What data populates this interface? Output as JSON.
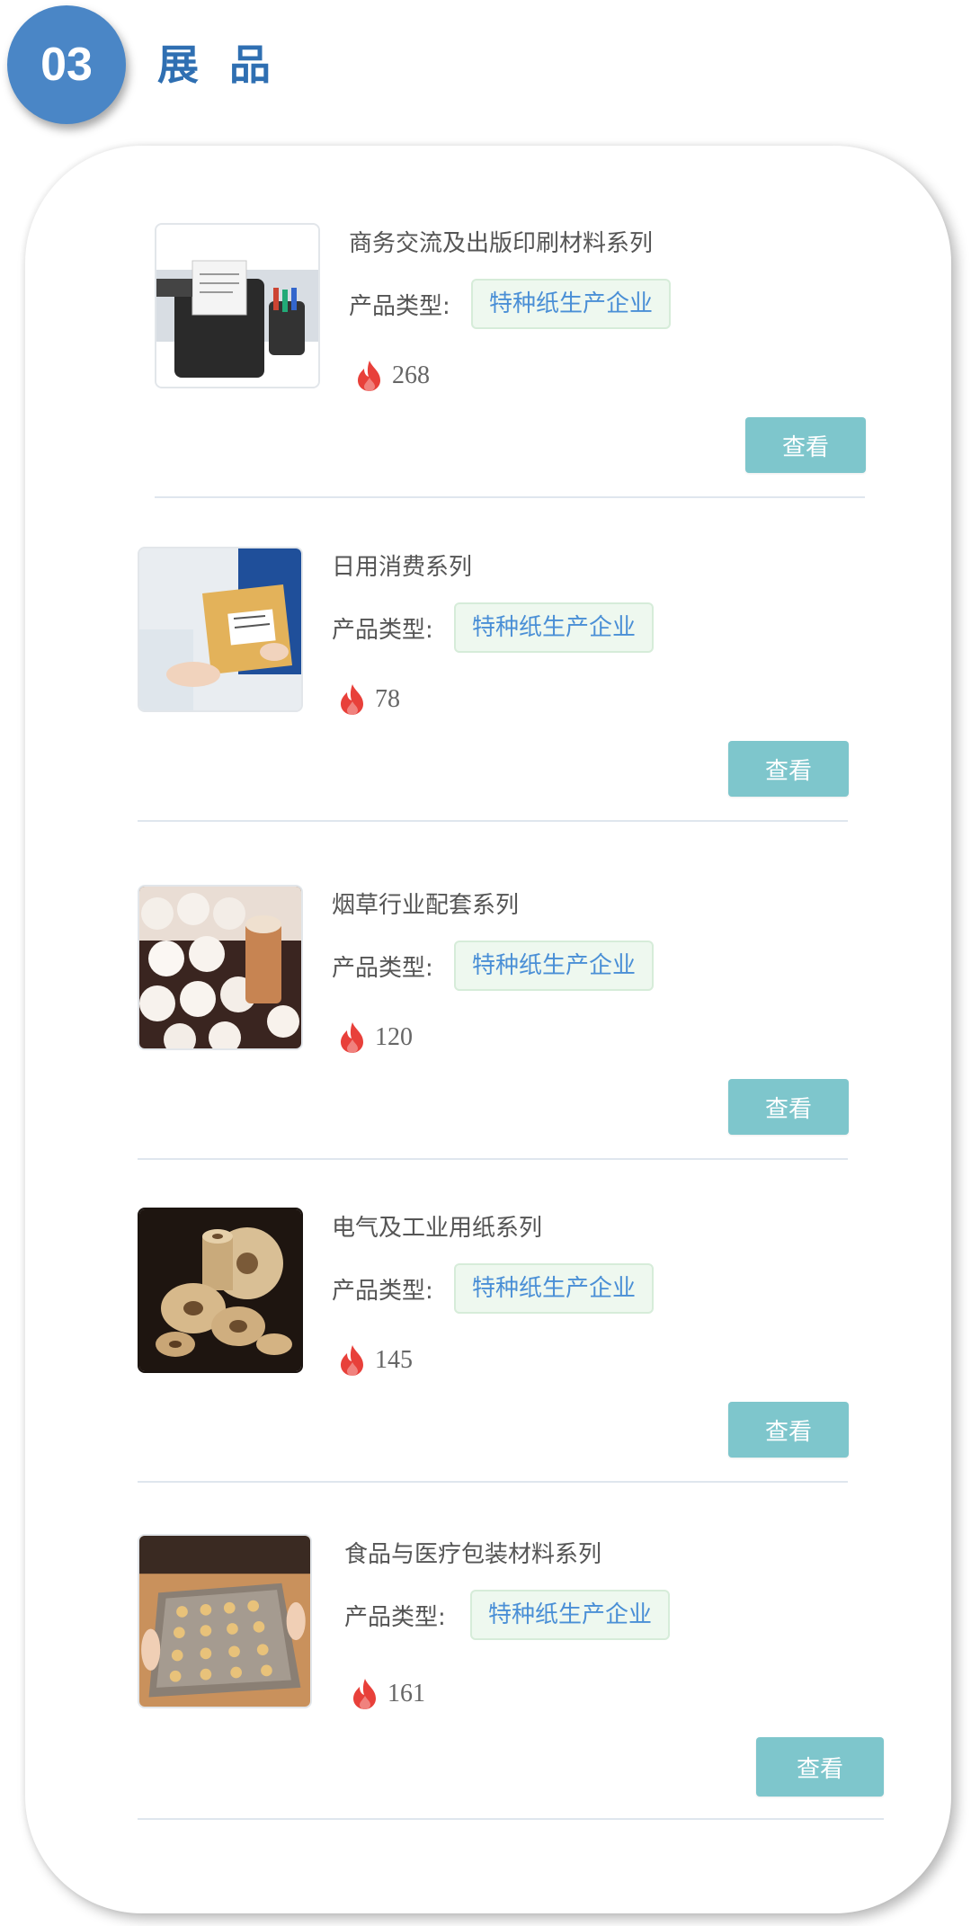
{
  "section": {
    "number": "03",
    "title": "展品"
  },
  "items": [
    {
      "title": "商务交流及出版印刷材料系列",
      "type_label": "产品类型:",
      "type_tag": "特种纸生产企业",
      "heat": "268",
      "button_label": "查看",
      "image": "receipt-printer-image"
    },
    {
      "title": "日用消费系列",
      "type_label": "产品类型:",
      "type_tag": "特种纸生产企业",
      "heat": "78",
      "button_label": "查看",
      "image": "courier-envelope-image"
    },
    {
      "title": "烟草行业配套系列",
      "type_label": "产品类型:",
      "type_tag": "特种纸生产企业",
      "heat": "120",
      "button_label": "查看",
      "image": "cigarette-filters-image"
    },
    {
      "title": "电气及工业用纸系列",
      "type_label": "产品类型:",
      "type_tag": "特种纸生产企业",
      "heat": "145",
      "button_label": "查看",
      "image": "paper-rolls-image"
    },
    {
      "title": "食品与医疗包装材料系列",
      "type_label": "产品类型:",
      "type_tag": "特种纸生产企业",
      "heat": "161",
      "button_label": "查看",
      "image": "baking-tray-image"
    }
  ],
  "colors": {
    "badge": "#4a86c6",
    "title": "#2f6fb2",
    "button": "#7ec6cc",
    "tag_text": "#4a8fd6",
    "tag_bg": "#eef8ef",
    "flame": "#e8403a"
  }
}
